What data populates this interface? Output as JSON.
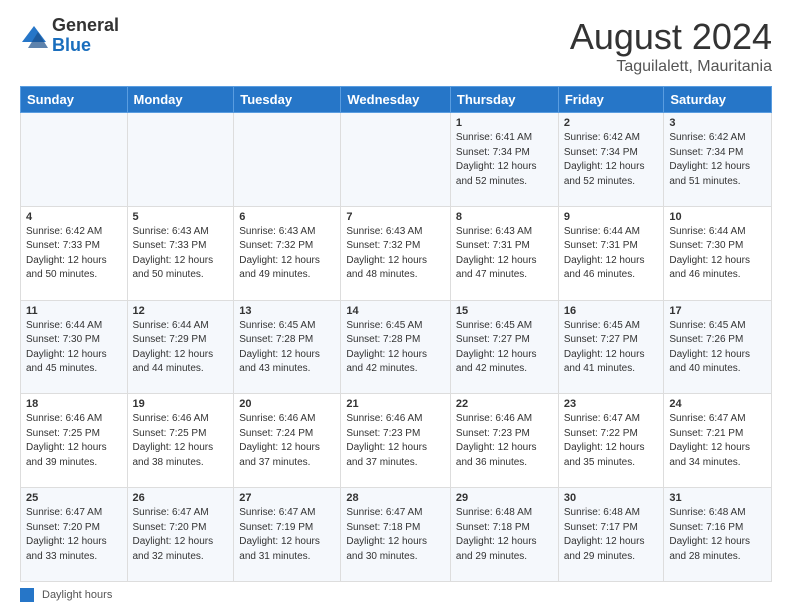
{
  "header": {
    "logo_general": "General",
    "logo_blue": "Blue",
    "month_year": "August 2024",
    "location": "Taguilalett, Mauritania"
  },
  "days_of_week": [
    "Sunday",
    "Monday",
    "Tuesday",
    "Wednesday",
    "Thursday",
    "Friday",
    "Saturday"
  ],
  "weeks": [
    [
      {
        "day": "",
        "info": ""
      },
      {
        "day": "",
        "info": ""
      },
      {
        "day": "",
        "info": ""
      },
      {
        "day": "",
        "info": ""
      },
      {
        "day": "1",
        "info": "Sunrise: 6:41 AM\nSunset: 7:34 PM\nDaylight: 12 hours\nand 52 minutes."
      },
      {
        "day": "2",
        "info": "Sunrise: 6:42 AM\nSunset: 7:34 PM\nDaylight: 12 hours\nand 52 minutes."
      },
      {
        "day": "3",
        "info": "Sunrise: 6:42 AM\nSunset: 7:34 PM\nDaylight: 12 hours\nand 51 minutes."
      }
    ],
    [
      {
        "day": "4",
        "info": "Sunrise: 6:42 AM\nSunset: 7:33 PM\nDaylight: 12 hours\nand 50 minutes."
      },
      {
        "day": "5",
        "info": "Sunrise: 6:43 AM\nSunset: 7:33 PM\nDaylight: 12 hours\nand 50 minutes."
      },
      {
        "day": "6",
        "info": "Sunrise: 6:43 AM\nSunset: 7:32 PM\nDaylight: 12 hours\nand 49 minutes."
      },
      {
        "day": "7",
        "info": "Sunrise: 6:43 AM\nSunset: 7:32 PM\nDaylight: 12 hours\nand 48 minutes."
      },
      {
        "day": "8",
        "info": "Sunrise: 6:43 AM\nSunset: 7:31 PM\nDaylight: 12 hours\nand 47 minutes."
      },
      {
        "day": "9",
        "info": "Sunrise: 6:44 AM\nSunset: 7:31 PM\nDaylight: 12 hours\nand 46 minutes."
      },
      {
        "day": "10",
        "info": "Sunrise: 6:44 AM\nSunset: 7:30 PM\nDaylight: 12 hours\nand 46 minutes."
      }
    ],
    [
      {
        "day": "11",
        "info": "Sunrise: 6:44 AM\nSunset: 7:30 PM\nDaylight: 12 hours\nand 45 minutes."
      },
      {
        "day": "12",
        "info": "Sunrise: 6:44 AM\nSunset: 7:29 PM\nDaylight: 12 hours\nand 44 minutes."
      },
      {
        "day": "13",
        "info": "Sunrise: 6:45 AM\nSunset: 7:28 PM\nDaylight: 12 hours\nand 43 minutes."
      },
      {
        "day": "14",
        "info": "Sunrise: 6:45 AM\nSunset: 7:28 PM\nDaylight: 12 hours\nand 42 minutes."
      },
      {
        "day": "15",
        "info": "Sunrise: 6:45 AM\nSunset: 7:27 PM\nDaylight: 12 hours\nand 42 minutes."
      },
      {
        "day": "16",
        "info": "Sunrise: 6:45 AM\nSunset: 7:27 PM\nDaylight: 12 hours\nand 41 minutes."
      },
      {
        "day": "17",
        "info": "Sunrise: 6:45 AM\nSunset: 7:26 PM\nDaylight: 12 hours\nand 40 minutes."
      }
    ],
    [
      {
        "day": "18",
        "info": "Sunrise: 6:46 AM\nSunset: 7:25 PM\nDaylight: 12 hours\nand 39 minutes."
      },
      {
        "day": "19",
        "info": "Sunrise: 6:46 AM\nSunset: 7:25 PM\nDaylight: 12 hours\nand 38 minutes."
      },
      {
        "day": "20",
        "info": "Sunrise: 6:46 AM\nSunset: 7:24 PM\nDaylight: 12 hours\nand 37 minutes."
      },
      {
        "day": "21",
        "info": "Sunrise: 6:46 AM\nSunset: 7:23 PM\nDaylight: 12 hours\nand 37 minutes."
      },
      {
        "day": "22",
        "info": "Sunrise: 6:46 AM\nSunset: 7:23 PM\nDaylight: 12 hours\nand 36 minutes."
      },
      {
        "day": "23",
        "info": "Sunrise: 6:47 AM\nSunset: 7:22 PM\nDaylight: 12 hours\nand 35 minutes."
      },
      {
        "day": "24",
        "info": "Sunrise: 6:47 AM\nSunset: 7:21 PM\nDaylight: 12 hours\nand 34 minutes."
      }
    ],
    [
      {
        "day": "25",
        "info": "Sunrise: 6:47 AM\nSunset: 7:20 PM\nDaylight: 12 hours\nand 33 minutes."
      },
      {
        "day": "26",
        "info": "Sunrise: 6:47 AM\nSunset: 7:20 PM\nDaylight: 12 hours\nand 32 minutes."
      },
      {
        "day": "27",
        "info": "Sunrise: 6:47 AM\nSunset: 7:19 PM\nDaylight: 12 hours\nand 31 minutes."
      },
      {
        "day": "28",
        "info": "Sunrise: 6:47 AM\nSunset: 7:18 PM\nDaylight: 12 hours\nand 30 minutes."
      },
      {
        "day": "29",
        "info": "Sunrise: 6:48 AM\nSunset: 7:18 PM\nDaylight: 12 hours\nand 29 minutes."
      },
      {
        "day": "30",
        "info": "Sunrise: 6:48 AM\nSunset: 7:17 PM\nDaylight: 12 hours\nand 29 minutes."
      },
      {
        "day": "31",
        "info": "Sunrise: 6:48 AM\nSunset: 7:16 PM\nDaylight: 12 hours\nand 28 minutes."
      }
    ]
  ],
  "footer": {
    "legend_label": "Daylight hours"
  }
}
